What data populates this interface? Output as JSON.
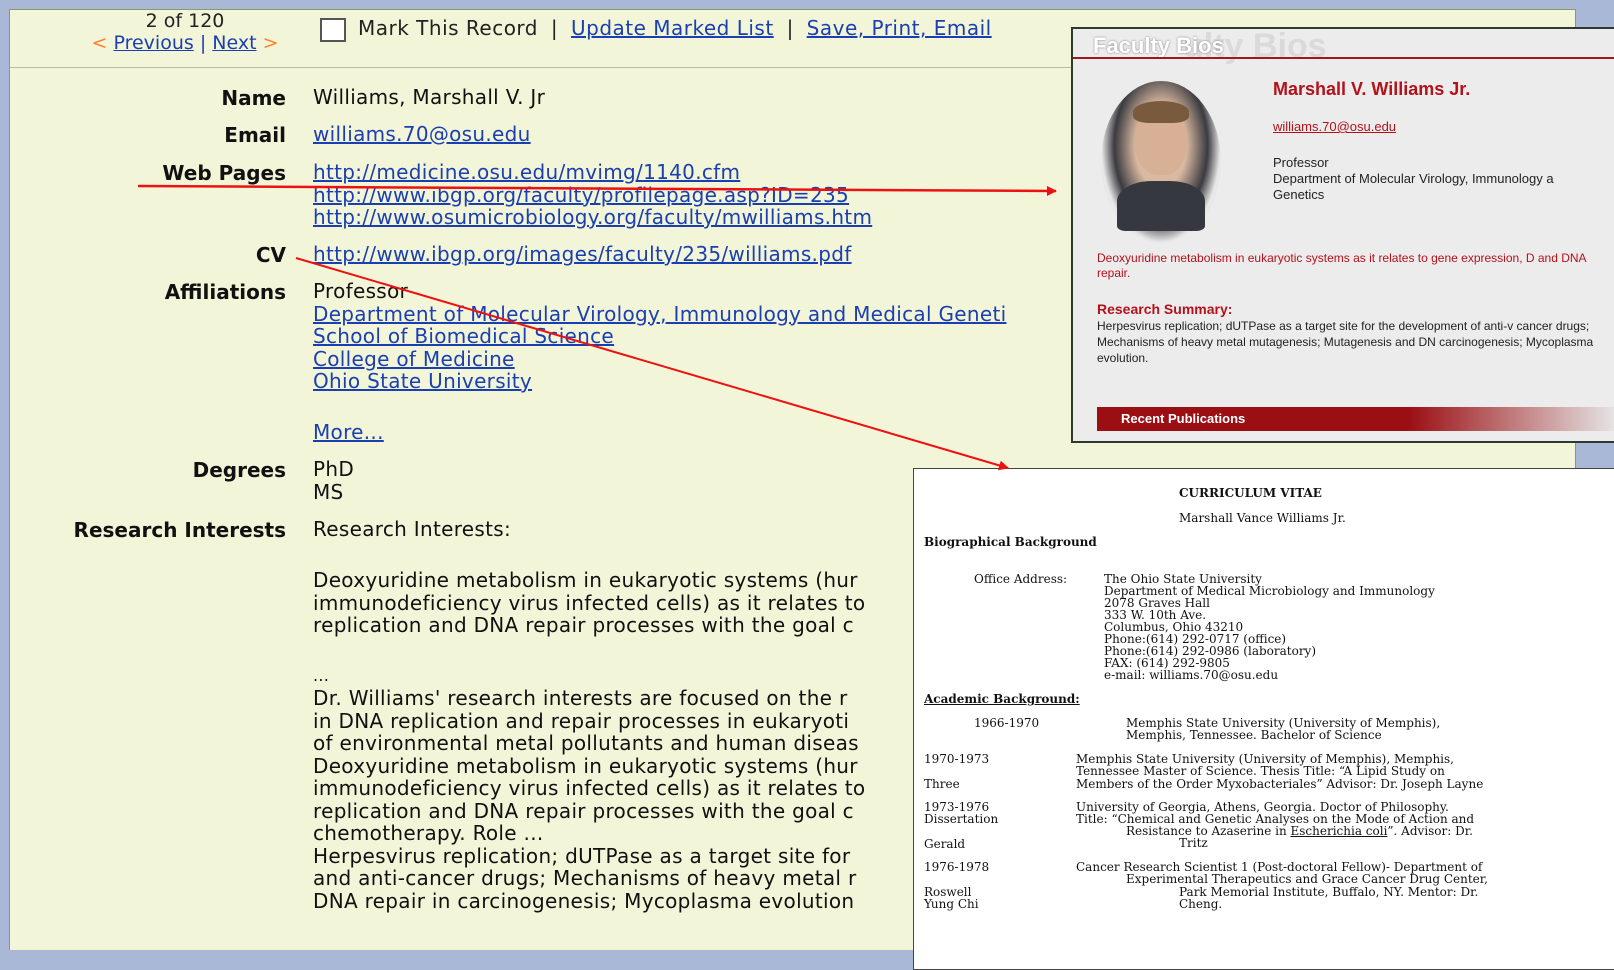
{
  "record_nav": {
    "count": "2 of 120",
    "prev_glyph": "<",
    "previous": "Previous",
    "separator": "|",
    "next": "Next",
    "next_glyph": ">"
  },
  "toolbar": {
    "mark_record": "Mark This Record",
    "sep": "|",
    "update_marked": "Update Marked List",
    "save_print": "Save, Print, Email"
  },
  "record": {
    "name_label": "Name",
    "name": "Williams, Marshall V. Jr",
    "email_label": "Email",
    "email": "williams.70@osu.edu",
    "web_label": "Web Pages",
    "web": [
      "http://medicine.osu.edu/mvimg/1140.cfm",
      "http://www.ibgp.org/faculty/profilepage.asp?ID=235",
      "http://www.osumicrobiology.org/faculty/mwilliams.htm"
    ],
    "cv_label": "CV",
    "cv": "http://www.ibgp.org/images/faculty/235/williams.pdf",
    "aff_label": "Affiliations",
    "aff_title": "Professor",
    "affiliations": [
      "Department of Molecular Virology, Immunology and Medical Geneti",
      "School of Biomedical Science",
      "College of Medicine",
      "Ohio State University"
    ],
    "more": "More...",
    "deg_label": "Degrees",
    "degrees": [
      "PhD",
      "MS"
    ],
    "ri_label": "Research Interests",
    "ri_head": "Research Interests:",
    "ri_para1": [
      "Deoxyuridine metabolism in eukaryotic systems (hur",
      "immunodeficiency virus infected cells) as it relates to",
      "replication and DNA repair processes with the goal c"
    ],
    "ellipsis": "...",
    "ri_para2": [
      "Dr. Williams' research interests are focused on the r",
      "in DNA replication and repair processes in eukaryoti",
      "of environmental metal pollutants and human diseas",
      "Deoxyuridine metabolism in eukaryotic systems (hur",
      "immunodeficiency virus infected cells) as it relates to",
      "replication and DNA repair processes with the goal c",
      "chemotherapy. Role ...",
      "Herpesvirus replication; dUTPase as a target site for",
      "and anti-cancer drugs; Mechanisms of heavy metal r",
      "DNA repair in carcinogenesis; Mycoplasma evolution"
    ]
  },
  "bios": {
    "header": "Faculty Bios",
    "ghost": "ulty Bios",
    "name": "Marshall V. Williams Jr.",
    "email": "williams.70@osu.edu",
    "title_lines": [
      "Professor",
      "Department of Molecular Virology, Immunology a",
      "Genetics"
    ],
    "interest": "Deoxyuridine metabolism in eukaryotic systems as it relates to gene expression, D and DNA repair.",
    "rs_head": "Research Summary:",
    "rs_text": "Herpesvirus replication; dUTPase as a target site for the development of anti-v cancer drugs; Mechanisms of heavy metal mutagenesis; Mutagenesis and DN carcinogenesis; Mycoplasma evolution.",
    "pub_bar": "Recent Publications"
  },
  "cv": {
    "title": "CURRICULUM VITAE",
    "name": "Marshall Vance Williams Jr.",
    "bio_head": "Biographical Background",
    "office_label": "Office Address:",
    "office": [
      "The Ohio State University",
      "Department of Medical Microbiology and Immunology",
      "2078 Graves Hall",
      "333 W. 10th Ave.",
      "Columbus, Ohio 43210",
      "Phone:(614) 292-0717 (office)",
      "Phone:(614) 292-0986 (laboratory)",
      "FAX:    (614) 292-9805",
      "e-mail: williams.70@osu.edu"
    ],
    "acad_head": "Academic Background:",
    "r1_year": "1966-1970",
    "r1_l1": "Memphis State University (University of Memphis),",
    "r1_l2": "Memphis, Tennessee. Bachelor of Science",
    "r2_year": "1970-1973",
    "r2_l1": "Memphis State University (University of Memphis),  Memphis,",
    "r2_l2": "Tennessee Master of Science. Thesis Title:  “A Lipid Study on",
    "r2_side": "Three",
    "r2_l3": "Members of the Order Myxobacteriales” Advisor: Dr. Joseph Layne",
    "r3_year": "1973-1976",
    "r3_side": "Dissertation",
    "r3_l1": "University of Georgia, Athens, Georgia. Doctor of Philosophy.",
    "r3_l2": "Title:   “Chemical and Genetic Analyses on the Mode of Action and",
    "r3_l3a": "Resistance to Azaserine in ",
    "r3_l3b": "Escherichia  coli",
    "r3_l3c": "”.  Advisor: Dr.",
    "r3_side2": "Gerald",
    "r3_l4": "Tritz",
    "r4_year": "1976-1978",
    "r4_l1": "Cancer Research Scientist 1 (Post-doctoral Fellow)-  Department of",
    "r4_l2": "Experimental Therapeutics and Grace Cancer Drug Center,",
    "r4_side": "Roswell",
    "r4_l3": "Park Memorial Institute, Buffalo, NY.  Mentor: Dr.",
    "r4_side2": "Yung Chi",
    "r4_l4": "Cheng."
  },
  "colors": {
    "arrow": "#ee1111",
    "bios_accent": "#b3121b",
    "link": "#1a3fb0"
  }
}
